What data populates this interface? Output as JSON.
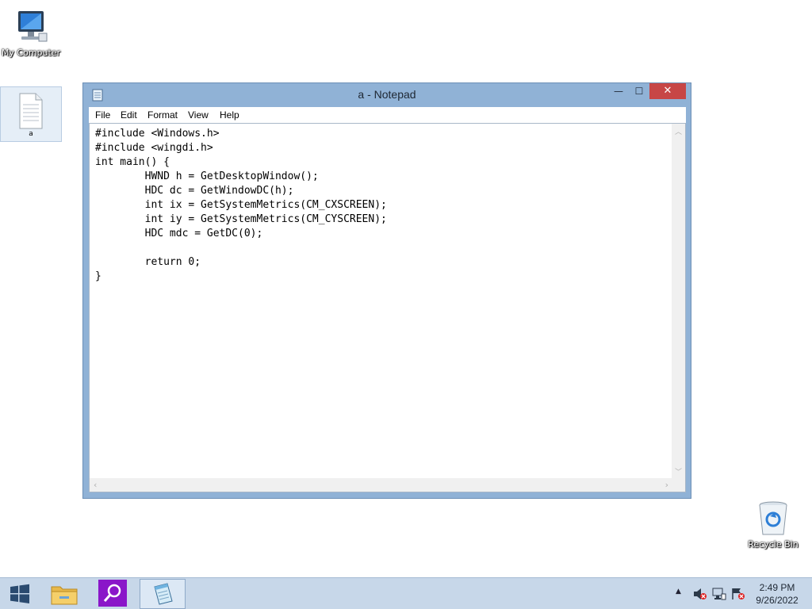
{
  "desktop": {
    "icons": [
      {
        "label": "My Computer",
        "icon": "computer-icon"
      },
      {
        "label": "a",
        "icon": "text-file-icon"
      },
      {
        "label": "Recycle Bin",
        "icon": "recycle-bin-icon"
      }
    ]
  },
  "window": {
    "title": "a - Notepad",
    "menu": [
      "File",
      "Edit",
      "Format",
      "View",
      "Help"
    ],
    "controls": {
      "minimize": "—",
      "maximize": "☐",
      "close": "✕"
    },
    "content": "#include <Windows.h>\n#include <wingdi.h>\nint main() {\n        HWND h = GetDesktopWindow();\n        HDC dc = GetWindowDC(h);\n        int ix = GetSystemMetrics(CM_CXSCREEN);\n        int iy = GetSystemMetrics(CM_CYSCREEN);\n        HDC mdc = GetDC(0);\n\n        return 0;\n}"
  },
  "taskbar": {
    "items": [
      {
        "name": "start",
        "icon": "windows-logo-icon"
      },
      {
        "name": "file-explorer",
        "icon": "folder-icon"
      },
      {
        "name": "search",
        "icon": "magnifier-icon"
      },
      {
        "name": "notepad",
        "icon": "notepad-icon",
        "active": true
      }
    ],
    "tray": {
      "chevron": "▲"
    },
    "clock": {
      "time": "2:49 PM",
      "date": "9/26/2022"
    }
  },
  "colors": {
    "window_frame": "#90b2d6",
    "close_button": "#c74646",
    "taskbar": "#c7d7e9",
    "search_tile": "#8a16c9"
  }
}
